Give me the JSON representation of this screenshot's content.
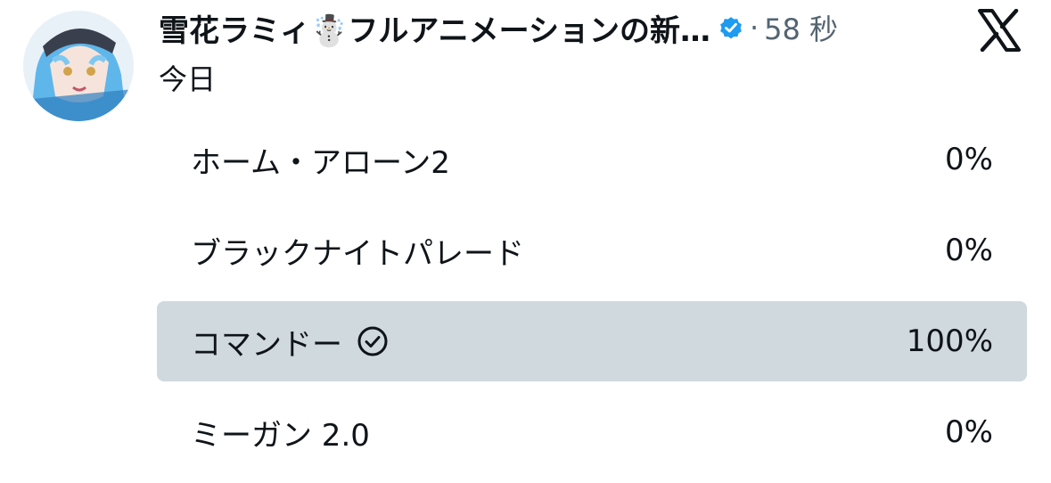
{
  "tweet": {
    "display_name": "雪花ラミィ☃️フルアニメーションの新…",
    "separator": "·",
    "time": "58 秒",
    "subtitle": "今日"
  },
  "icons": {
    "avatar": "avatar-image",
    "verified": "verified-badge-icon",
    "brand": "x-logo-icon",
    "winner": "check-circle-icon"
  },
  "colors": {
    "verified": "#1d9bf0",
    "winner_fill": "#cfd9de",
    "text": "#0f1419",
    "muted": "#536471"
  },
  "poll": {
    "options": [
      {
        "label": "ホーム・アローン2",
        "percent": "0%",
        "fraction": 0,
        "winner": false
      },
      {
        "label": "ブラックナイトパレード",
        "percent": "0%",
        "fraction": 0,
        "winner": false
      },
      {
        "label": "コマンドー",
        "percent": "100%",
        "fraction": 1,
        "winner": true
      },
      {
        "label": "ミーガン 2.0",
        "percent": "0%",
        "fraction": 0,
        "winner": false
      }
    ]
  }
}
